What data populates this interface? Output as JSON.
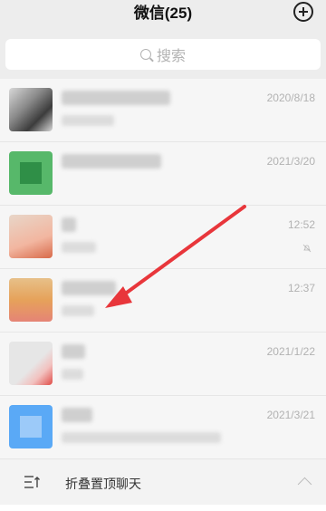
{
  "header": {
    "title": "微信(25)",
    "add_icon": "plus-circle-icon"
  },
  "search": {
    "label": "搜索",
    "icon": "search-icon"
  },
  "chats": [
    {
      "time": "2020/8/18",
      "muted": false,
      "avatar_colors": [
        "#8a8a8a",
        "#3c3c3c",
        "#d8d8d8"
      ]
    },
    {
      "time": "2021/3/20",
      "muted": false,
      "avatar_colors": [
        "#57b86a",
        "#2f8f47",
        "#8fd39c"
      ]
    },
    {
      "time": "12:52",
      "muted": true,
      "avatar_colors": [
        "#f2b6a0",
        "#e8d6c8",
        "#d86a4a"
      ]
    },
    {
      "time": "12:37",
      "muted": false,
      "avatar_colors": [
        "#e7c089",
        "#e6a25a",
        "#e58476"
      ]
    },
    {
      "time": "2021/1/22",
      "muted": false,
      "avatar_colors": [
        "#e6e6e6",
        "#f2c1bf",
        "#e04b46"
      ]
    },
    {
      "time": "2021/3/21",
      "muted": false,
      "avatar_colors": [
        "#5aa9f6",
        "#9ccaf9",
        "#3d8ce8"
      ]
    }
  ],
  "fold": {
    "label": "折叠置顶聊天",
    "icon": "fold-pinned-icon",
    "chevron": "chevron-up-icon"
  },
  "annotation": {
    "color": "#e8363b"
  }
}
